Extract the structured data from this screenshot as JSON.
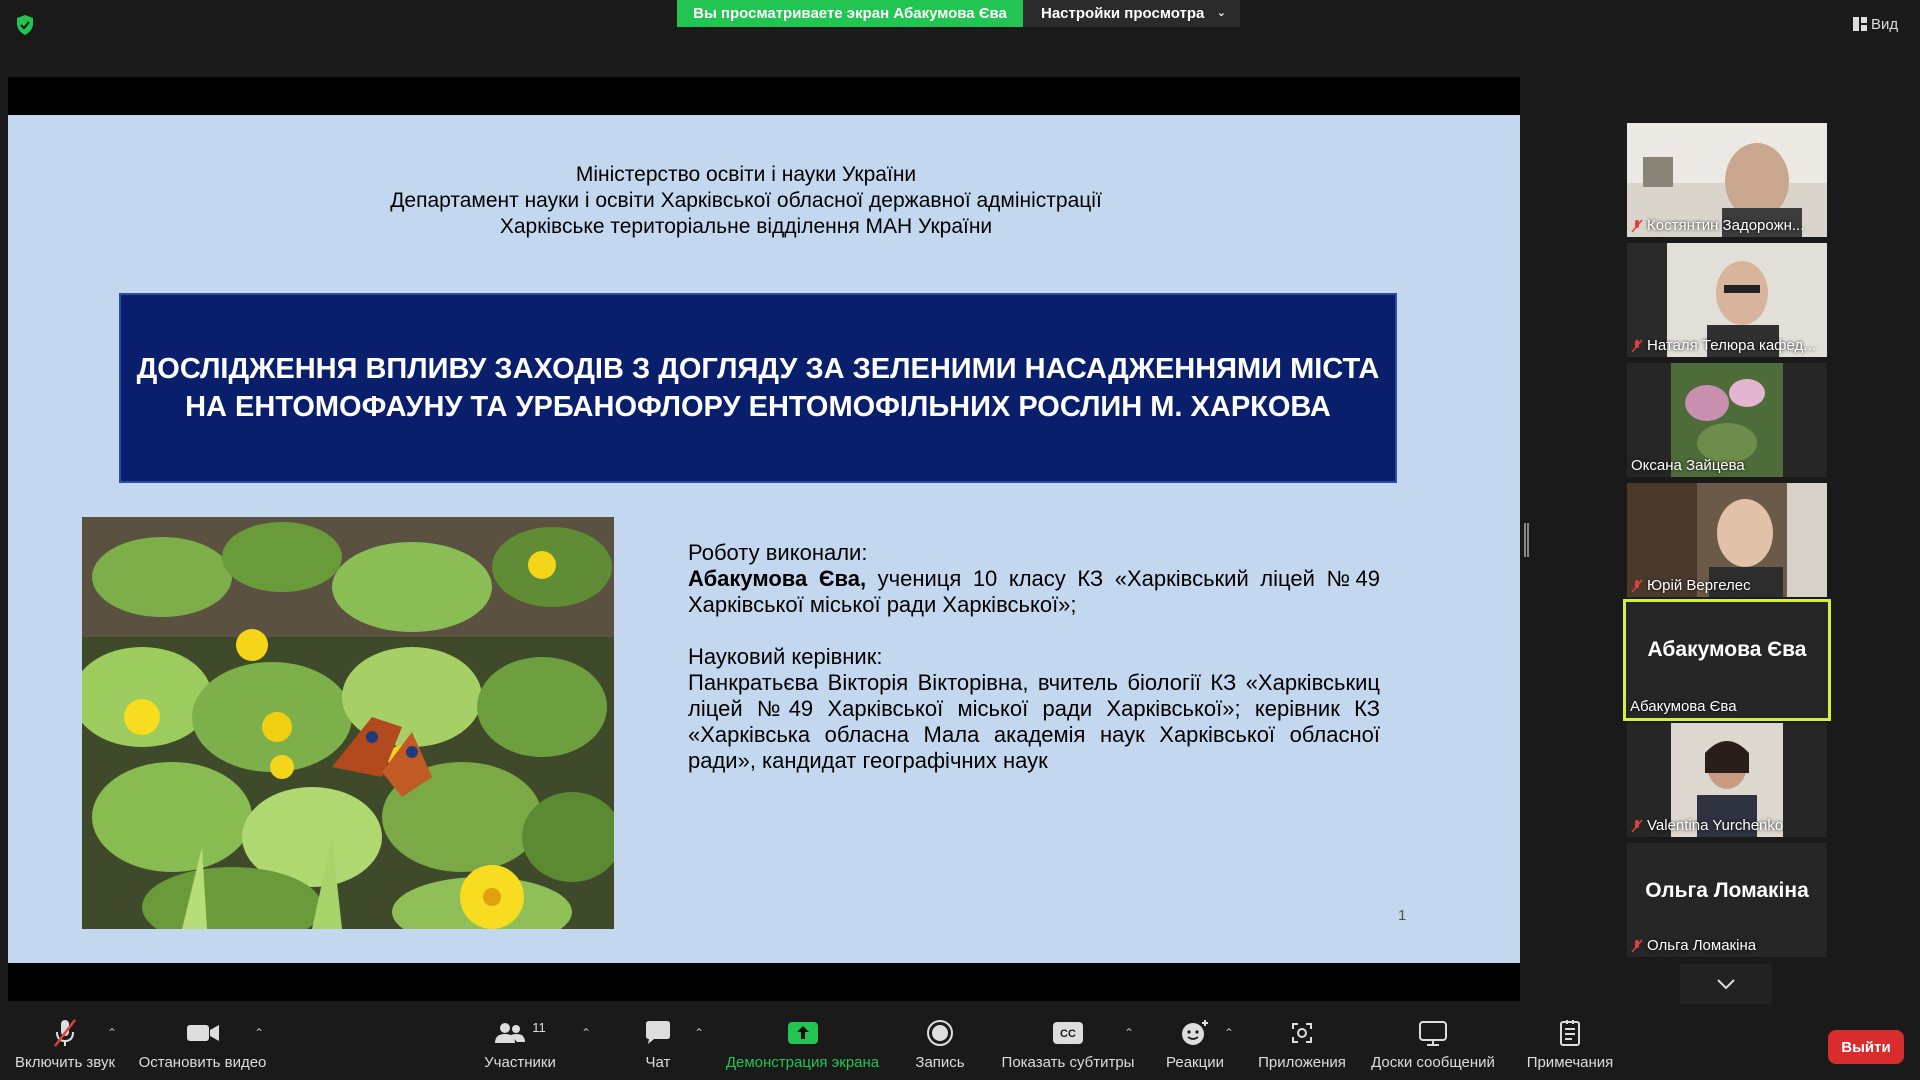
{
  "top": {
    "share_banner": "Вы просматриваете экран Абакумова Єва",
    "view_settings": "Настройки просмотра",
    "view_button": "Вид"
  },
  "slide": {
    "header_lines": [
      "Міністерство освіти і науки України",
      "Департамент науки і освіти Харківської обласної державної адміністрації",
      "Харківське територіальне відділення МАН України"
    ],
    "title": "ДОСЛІДЖЕННЯ ВПЛИВУ ЗАХОДІВ З ДОГЛЯДУ ЗА ЗЕЛЕНИМИ НАСАДЖЕННЯМИ МІСТА НА ЕНТОМОФАУНУ ТА УРБАНОФЛОРУ ЕНТОМОФІЛЬНИХ РОСЛИН М. ХАРКОВА",
    "authors_label": "Роботу виконали:",
    "author_name": "Абакумова Єва,",
    "author_desc": " учениця 10 класу КЗ «Харківський ліцей №49 Харківської міської ради Харківської»;",
    "supervisor_label": "Науковий керівник:",
    "supervisor_desc": "Панкратьєва Вікторія Вікторівна, вчитель біології КЗ «Харківськиц ліцей №49 Харківської міської ради Харківської»; керівник КЗ «Харківська обласна Мала академія наук Харківської обласної ради», кандидат географічних наук",
    "page_number": "1"
  },
  "participants": [
    {
      "name": "Костянтин Задорожн...",
      "muted": true,
      "video": true
    },
    {
      "name": "Наталя Телюра кафед...",
      "muted": true,
      "video": true
    },
    {
      "name": "Оксана Зайцева",
      "muted": false,
      "video": true
    },
    {
      "name": "Юрій Вергелес",
      "muted": true,
      "video": true
    },
    {
      "name": "Абакумова Єва",
      "display": "Абакумова Єва",
      "muted": false,
      "video": false,
      "active": true
    },
    {
      "name": "Valentina Yurchenko",
      "muted": true,
      "video": true
    },
    {
      "name": "Ольга Ломакіна",
      "display": "Ольга Ломакіна",
      "muted": true,
      "video": false
    }
  ],
  "toolbar": {
    "unmute": "Включить звук",
    "stop_video": "Остановить видео",
    "participants": "Участники",
    "participants_count": "11",
    "chat": "Чат",
    "share_screen": "Демонстрация экрана",
    "record": "Запись",
    "captions": "Показать субтитры",
    "reactions": "Реакции",
    "apps": "Приложения",
    "whiteboards": "Доски сообщений",
    "notes": "Примечания",
    "leave": "Выйти"
  },
  "colors": {
    "share_green": "#23c552",
    "slide_bg": "#c3d8ef",
    "title_bg": "#0a1f6b",
    "active_border": "#d4f03c",
    "leave_red": "#d92d2d"
  }
}
